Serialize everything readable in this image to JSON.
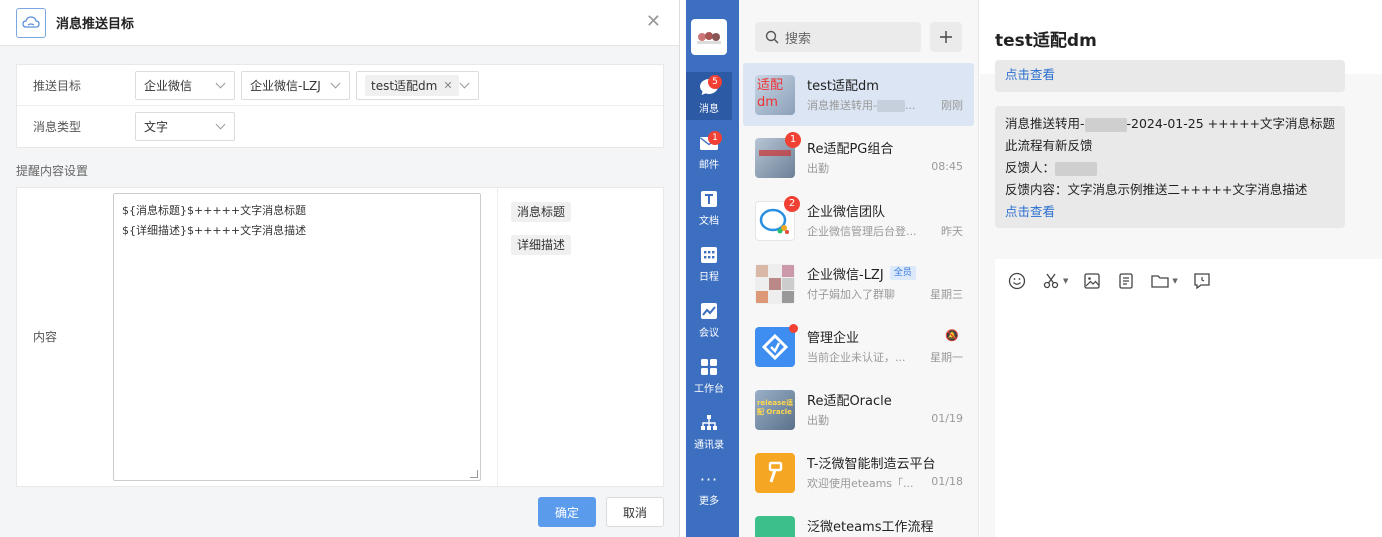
{
  "dialog": {
    "title": "消息推送目标",
    "form": {
      "target_label": "推送目标",
      "target_select_1": "企业微信",
      "target_select_2": "企业微信-LZJ",
      "target_tag": "test适配dm",
      "type_label": "消息类型",
      "type_select": "文字"
    },
    "section_title": "提醒内容设置",
    "content_label": "内容",
    "content_lines": [
      "${消息标题}$+++++文字消息标题",
      "${详细描述}$+++++文字消息描述"
    ],
    "var_buttons": [
      "消息标题",
      "详细描述"
    ],
    "ok_label": "确定",
    "cancel_label": "取消"
  },
  "nav": {
    "items": [
      {
        "label": "消息",
        "icon": "chat-bubble-icon",
        "badge": "5"
      },
      {
        "label": "邮件",
        "icon": "mail-icon",
        "badge": "1"
      },
      {
        "label": "文档",
        "icon": "document-icon",
        "badge": ""
      },
      {
        "label": "日程",
        "icon": "calendar-icon",
        "badge": ""
      },
      {
        "label": "会议",
        "icon": "meeting-icon",
        "badge": ""
      },
      {
        "label": "工作台",
        "icon": "workbench-icon",
        "badge": ""
      },
      {
        "label": "通讯录",
        "icon": "contacts-icon",
        "badge": ""
      },
      {
        "label": "更多",
        "icon": "more-icon",
        "badge": ""
      }
    ]
  },
  "convlist": {
    "search_placeholder": "搜索",
    "items": [
      {
        "name": "test适配dm",
        "preview": "消息推送转用-",
        "preview_tail": "...",
        "time": "刚刚",
        "badge": "",
        "tag": ""
      },
      {
        "name": "Re适配PG组合",
        "preview": "出勤",
        "time": "08:45",
        "badge": "1",
        "tag": ""
      },
      {
        "name": "企业微信团队",
        "preview": "企业微信管理后台登...",
        "time": "昨天",
        "badge": "2",
        "tag": ""
      },
      {
        "name": "企业微信-LZJ",
        "preview": "付子娟加入了群聊",
        "time": "星期三",
        "badge": "",
        "tag": "全员"
      },
      {
        "name": "管理企业",
        "preview": "当前企业未认证，...",
        "time": "星期一",
        "badge": "",
        "tag": ""
      },
      {
        "name": "Re适配Oracle",
        "preview": "出勤",
        "time": "01/19",
        "badge": "",
        "tag": ""
      },
      {
        "name": "T-泛微智能制造云平台",
        "preview": "欢迎使用eteams「...",
        "time": "01/18",
        "badge": "",
        "tag": ""
      },
      {
        "name": "泛微eteams工作流程",
        "preview": "",
        "time": "",
        "badge": "",
        "tag": ""
      }
    ],
    "avatar_text": {
      "first": "适配dm",
      "re_oracle": "release适配 Oracle"
    }
  },
  "chat": {
    "title": "test适配dm",
    "first_link": "点击查看",
    "msg": {
      "line1_a": "消息推送转用-",
      "line1_b": "-2024-01-25 +++++文字消息标题",
      "line2": "此流程有新反馈",
      "line3": "反馈人：",
      "line4": "反馈内容：文字消息示例推送二+++++文字消息描述",
      "link": "点击查看"
    }
  },
  "colors": {
    "nav_bg": "#3c6fbf",
    "primary": "#5b9bec",
    "badge": "#f04134",
    "link": "#2a6fd0"
  }
}
